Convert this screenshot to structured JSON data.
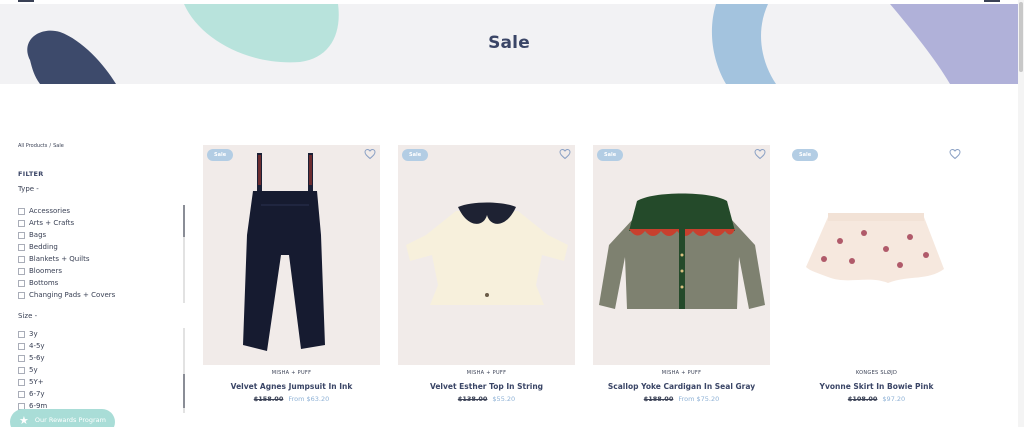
{
  "header": {
    "title": "Sale"
  },
  "breadcrumb": {
    "items": [
      "All Products",
      "/",
      "Sale"
    ]
  },
  "filter": {
    "title": "FILTER",
    "type_group": {
      "label": "Type -",
      "items": [
        "Accessories",
        "Arts + Crafts",
        "Bags",
        "Bedding",
        "Blankets + Quilts",
        "Bloomers",
        "Bottoms",
        "Changing Pads + Covers"
      ]
    },
    "size_group": {
      "label": "Size -",
      "items": [
        "3y",
        "4-5y",
        "5-6y",
        "5y",
        "5Y+",
        "6-7y",
        "6-9m"
      ]
    }
  },
  "rewards": {
    "label": "Our Rewards Program",
    "icon": "star-icon"
  },
  "products": [
    {
      "badge": "Sale",
      "brand": "MISHA + PUFF",
      "name": "Velvet Agnes Jumpsuit In Ink",
      "was_price": "$158.00",
      "now_price": "From $63.20"
    },
    {
      "badge": "Sale",
      "brand": "MISHA + PUFF",
      "name": "Velvet Esther Top In String",
      "was_price": "$138.00",
      "now_price": "$55.20"
    },
    {
      "badge": "Sale",
      "brand": "MISHA + PUFF",
      "name": "Scallop Yoke Cardigan In Seal Gray",
      "was_price": "$188.00",
      "now_price": "From $75.20"
    },
    {
      "badge": "Sale",
      "brand": "KONGES SLØJD",
      "name": "Yvonne Skirt In Bowie Pink",
      "was_price": "$108.00",
      "now_price": "$97.20"
    }
  ],
  "colors": {
    "banner_bg": "#f2f2f4",
    "title": "#3a4566",
    "badge": "#b3cde4",
    "sale_price": "#8fb2d6",
    "rewards": "#a9ddd7",
    "blob_mint": "#b8e3dc",
    "blob_navy": "#3d4a6b",
    "blob_blue": "#a3c3de",
    "blob_lavender": "#b0b1d9"
  }
}
